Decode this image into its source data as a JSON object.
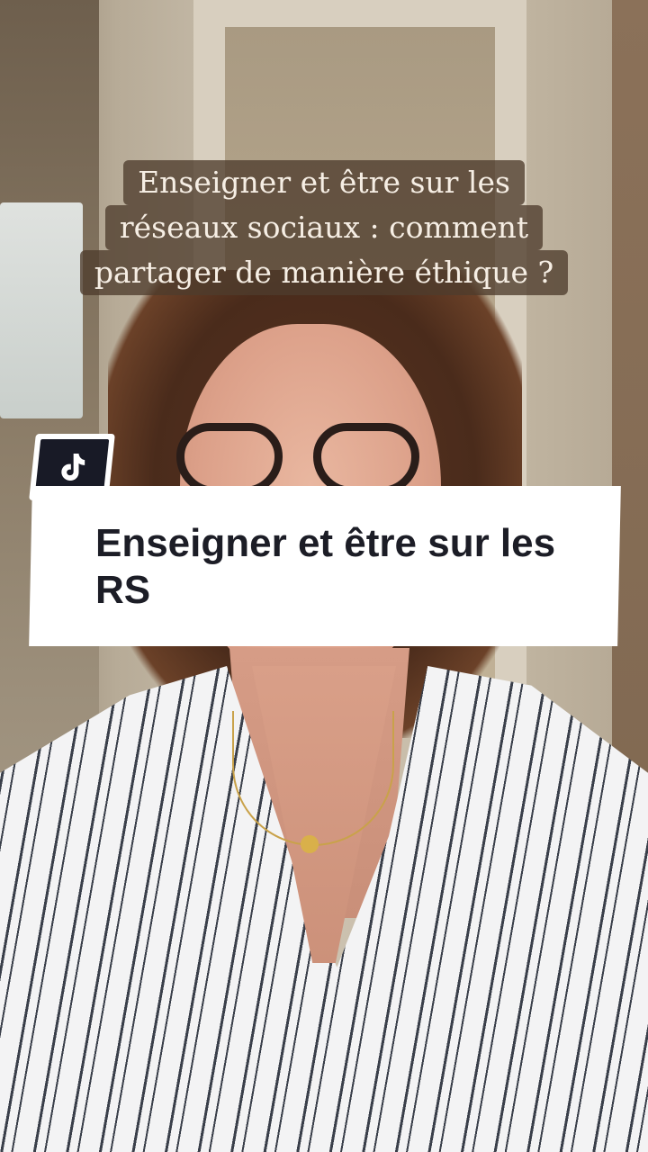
{
  "caption": {
    "lines": [
      "Enseigner et être sur les",
      "réseaux sociaux : comment",
      "partager de manière éthique ?"
    ]
  },
  "logo": {
    "icon": "tiktok-icon"
  },
  "title_card": {
    "text": "Enseigner et être sur les RS"
  },
  "colors": {
    "caption_bg": "#4e3c2d",
    "caption_text": "#f6eee4",
    "card_bg": "#ffffff",
    "card_text": "#1c1d26",
    "logo_bg": "#181a26"
  }
}
